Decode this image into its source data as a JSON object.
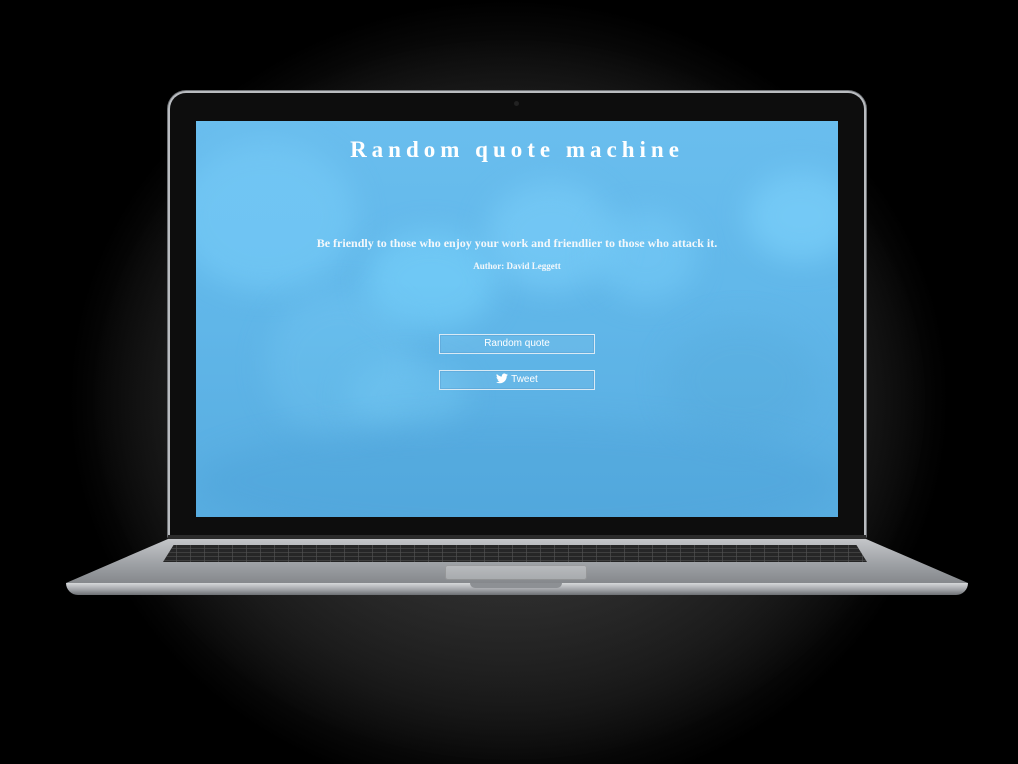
{
  "app": {
    "title": "Random quote machine"
  },
  "quote": {
    "text": "Be friendly to those who enjoy your work and friendlier to those who attack it.",
    "author_line": "Author: David Leggett"
  },
  "actions": {
    "random_label": "Random quote",
    "tweet_label": "Tweet",
    "tweet_icon": "twitter-bird-icon"
  },
  "colors": {
    "screen_background": "#62b8ea",
    "text": "#ffffff"
  }
}
